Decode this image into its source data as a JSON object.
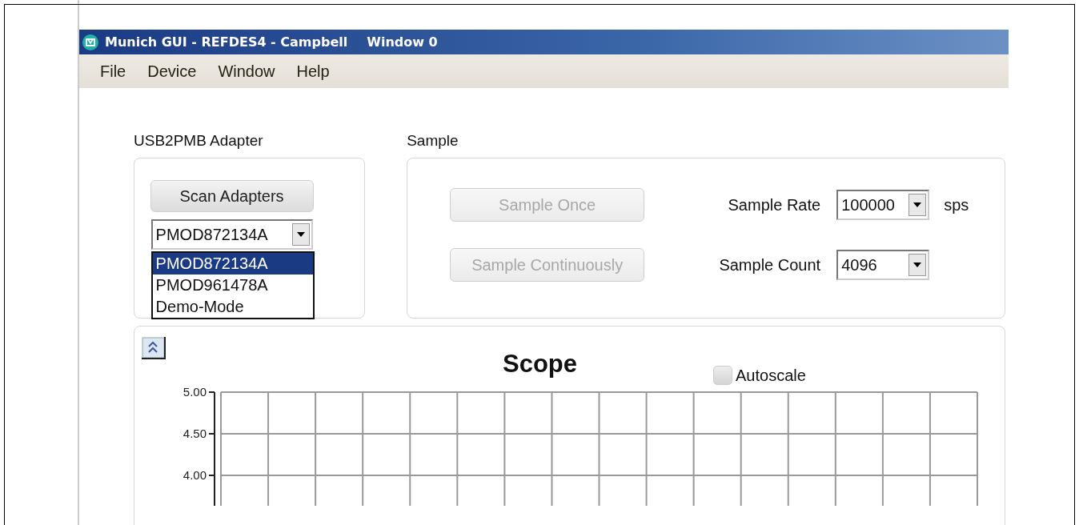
{
  "window": {
    "title": "Munich GUI - REFDES4 - Campbell",
    "subtitle": "Window 0"
  },
  "menu": [
    {
      "label": "File"
    },
    {
      "label": "Device"
    },
    {
      "label": "Window"
    },
    {
      "label": "Help"
    }
  ],
  "adapter": {
    "heading": "USB2PMB Adapter",
    "scan_button": "Scan Adapters",
    "combo": {
      "value": "PMOD872134A",
      "expanded": true
    },
    "options": [
      {
        "label": "PMOD872134A",
        "selected": true
      },
      {
        "label": "PMOD961478A",
        "selected": false
      },
      {
        "label": "Demo-Mode",
        "selected": false
      }
    ]
  },
  "sample": {
    "heading": "Sample",
    "buttons": [
      {
        "label": "Sample Once",
        "disabled": true
      },
      {
        "label": "Sample Continuously",
        "disabled": true
      }
    ],
    "fields": [
      {
        "label": "Sample Rate",
        "value": "100000",
        "unit": "sps"
      },
      {
        "label": "Sample Count",
        "value": "4096"
      }
    ]
  },
  "scope": {
    "autoscale": {
      "label": "Autoscale",
      "checked": false
    },
    "title": "Scope",
    "y_tick_labels": [
      "5.00",
      "4.50",
      "4.00"
    ]
  }
}
